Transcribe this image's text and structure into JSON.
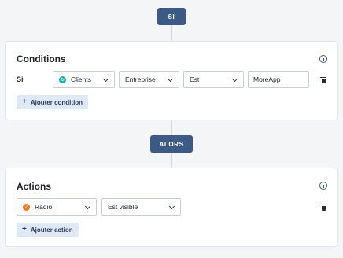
{
  "flow": {
    "if_label": "SI",
    "then_label": "ALORS"
  },
  "conditions": {
    "title": "Conditions",
    "row_label": "Si",
    "entity": "Clients",
    "field": "Entreprise",
    "operator": "Est",
    "value": "MoreApp",
    "add_label": "Ajouter condition",
    "entity_icon_color": "#19b5a8"
  },
  "actions": {
    "title": "Actions",
    "target": "Radio",
    "action": "Est visible",
    "add_label": "Ajouter action",
    "target_icon_color": "#f07b1c"
  },
  "colors": {
    "primary": "#3b5a85",
    "add_bg": "#dfe8f6"
  }
}
